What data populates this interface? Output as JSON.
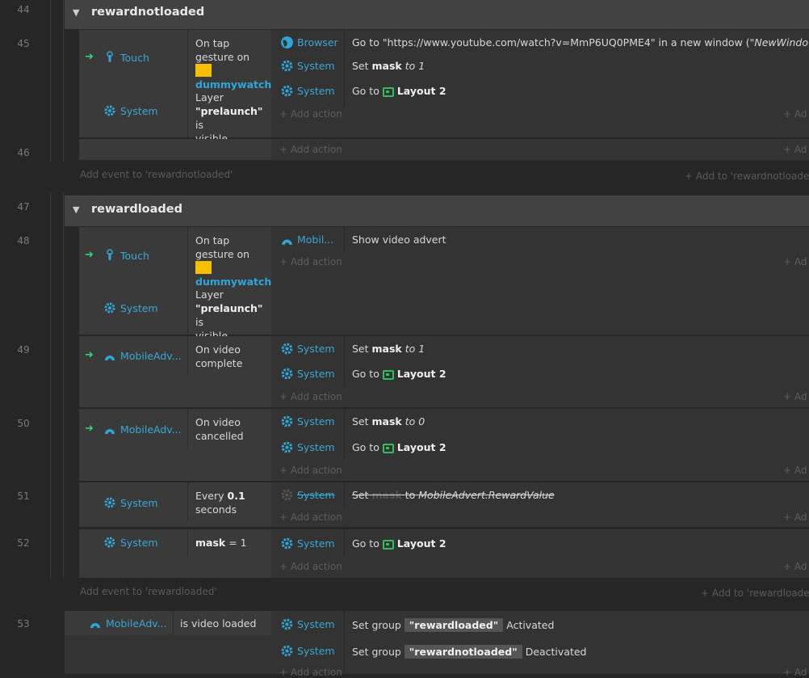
{
  "lines": [
    "44",
    "45",
    "46",
    "47",
    "48",
    "49",
    "50",
    "51",
    "52",
    "53"
  ],
  "groups": [
    {
      "name": "rewardnotloaded"
    },
    {
      "name": "rewardloaded"
    }
  ],
  "objects": {
    "touch": "Touch",
    "system": "System",
    "browser": "Browser",
    "mobile_short": "Mobil...",
    "mobileadv": "MobileAdv..."
  },
  "conditions": {
    "tap_1": "On tap gesture on",
    "tap_target": "dummywatch",
    "layer_1": "Layer",
    "layer_name": "\"prelaunch\"",
    "layer_2": "is",
    "layer_3": "visible",
    "video_complete": "On video complete",
    "video_cancelled": "On video cancelled",
    "every_1": "Every",
    "every_val": "0.1",
    "every_2": "seconds",
    "mask_var": "mask",
    "mask_op": "= 1",
    "is_loaded": "is video loaded"
  },
  "actions": {
    "goto_url": "Go to \"https://www.youtube.com/watch?v=MmP6UQ0PME4\" in a new window (\"",
    "goto_url_win": "NewWindow",
    "goto_url_end": "\")",
    "set": "Set",
    "mask": "mask",
    "to": "to",
    "one": "1",
    "zero": "0",
    "goto": "Go to",
    "layout2": "Layout 2",
    "show_video": "Show video advert",
    "reward_value": "MobileAdvert.RewardValue",
    "set_group": "Set group",
    "grp_loaded": "\"rewardloaded\"",
    "grp_notloaded": "\"rewardnotloaded\"",
    "activated": "Activated",
    "deactivated": "Deactivated"
  },
  "ui": {
    "add_action": "Add action",
    "add": "Ad",
    "add_event_notloaded": "Add event to 'rewardnotloaded'",
    "add_to_notloaded": "Add to 'rewardnotloaded'",
    "add_event_loaded": "Add event to 'rewardloaded'",
    "add_to_loaded": "Add to 'rewardloaded'"
  },
  "colors": {
    "link": "#2fa5d8",
    "swatch": "#f5c000",
    "layout": "#2fc05a",
    "trigger": "#33d17a"
  }
}
